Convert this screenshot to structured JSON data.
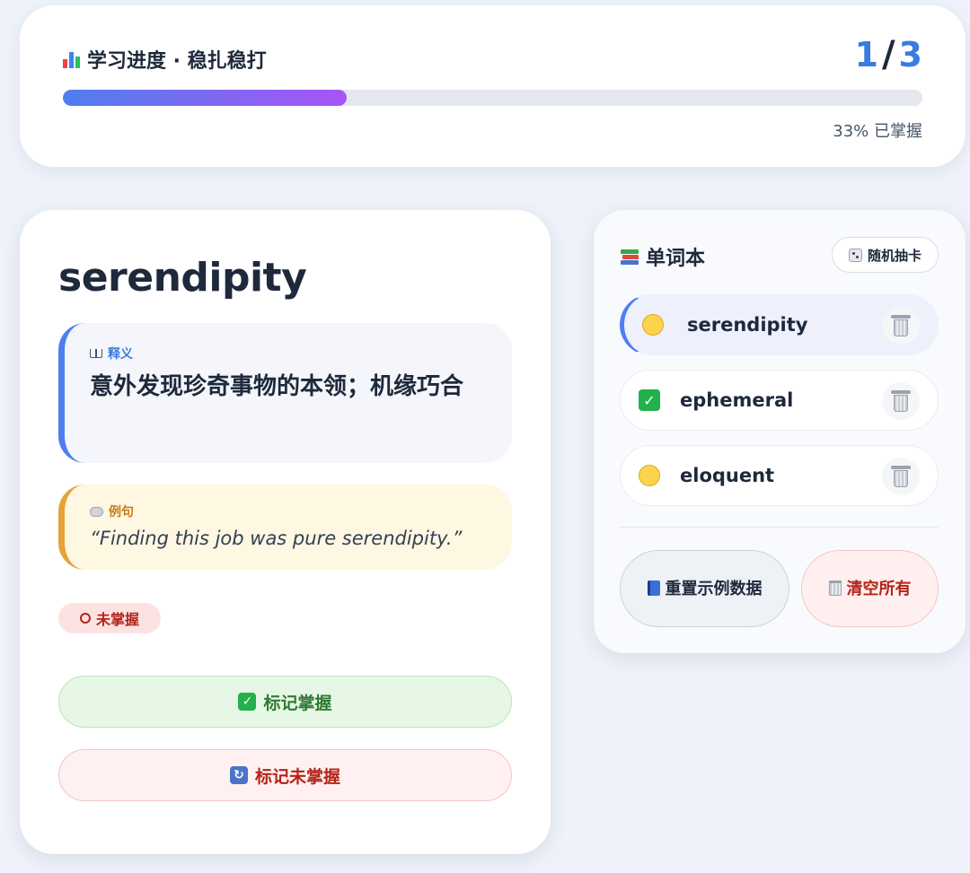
{
  "progress": {
    "title": "学习进度 · 稳扎稳打",
    "title_icon": "bar-chart-icon",
    "current": "1",
    "separator": "/",
    "total": "3",
    "percent": 33,
    "caption": "33% 已掌握",
    "bar_gradient": [
      "#4f7ef0",
      "#a855f7"
    ]
  },
  "card": {
    "word": "serendipity",
    "definition_label": "释义",
    "definition_icon": "open-book-icon",
    "definition": "意外发现珍奇事物的本领；机缘巧合",
    "example_label": "例句",
    "example_icon": "speech-bubble-icon",
    "example": "“Finding this job was pure serendipity.”",
    "status_label": "未掌握",
    "status_icon": "hollow-circle-icon",
    "mark_mastered_label": "标记掌握",
    "mark_unmastered_label": "标记未掌握"
  },
  "wordbook": {
    "title": "单词本",
    "title_icon": "books-icon",
    "random_label": "随机抽卡",
    "random_icon": "dice-icon",
    "items": [
      {
        "word": "serendipity",
        "status": "learning",
        "status_icon": "yellow-circle-icon",
        "active": true
      },
      {
        "word": "ephemeral",
        "status": "mastered",
        "status_icon": "check-mark-icon",
        "active": false
      },
      {
        "word": "eloquent",
        "status": "learning",
        "status_icon": "yellow-circle-icon",
        "active": false
      }
    ],
    "reset_label": "重置示例数据",
    "reset_icon": "blue-book-icon",
    "clear_label": "清空所有",
    "clear_icon": "wastebasket-icon"
  },
  "colors": {
    "accent": "#3b7be0",
    "success": "#2f7a32",
    "danger": "#b42318",
    "example_accent": "#e6a33a"
  }
}
